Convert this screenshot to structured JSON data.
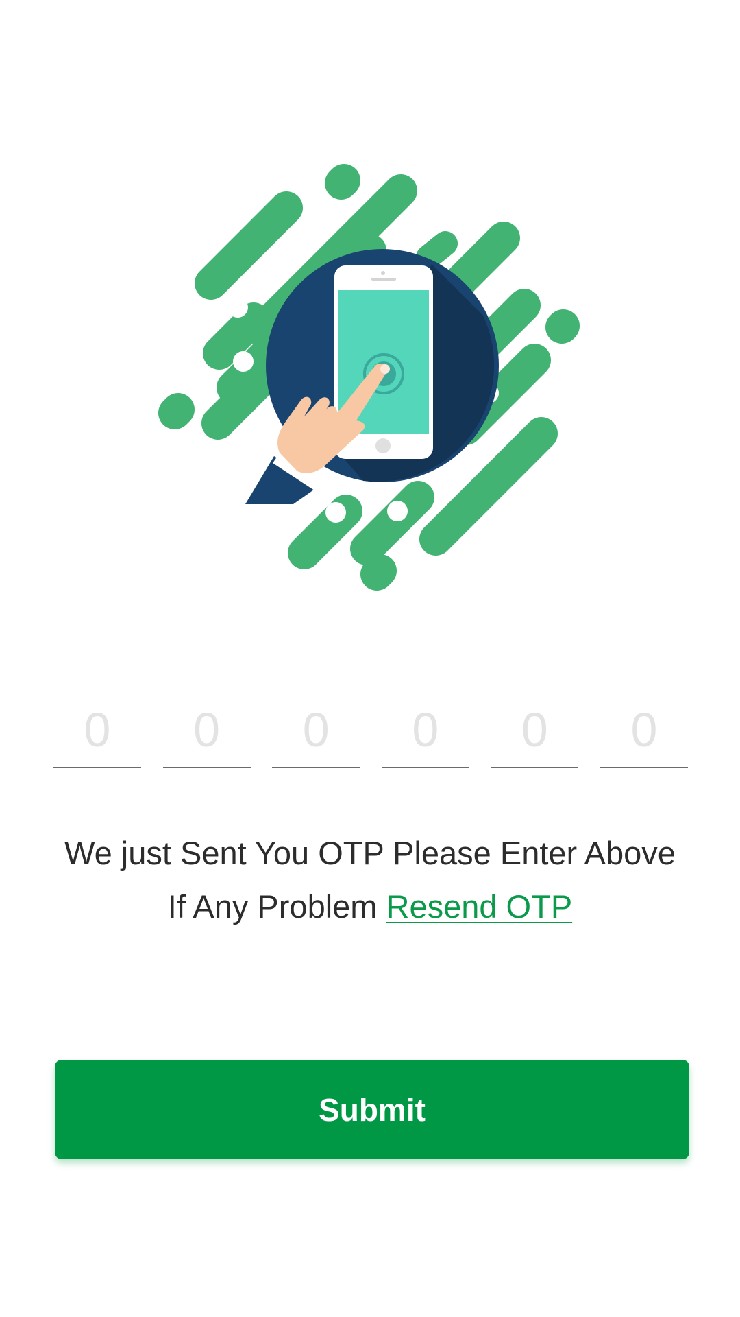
{
  "illustration": {
    "icon": "phone-tap-icon",
    "colors": {
      "stripes": "#43b374",
      "circle": "#1a4470",
      "screen": "#54d6bb",
      "phone": "#ffffff",
      "skin": "#f8c7a4",
      "sleeve": "#1a4470"
    }
  },
  "otp": {
    "digits": [
      {
        "placeholder": "0",
        "value": ""
      },
      {
        "placeholder": "0",
        "value": ""
      },
      {
        "placeholder": "0",
        "value": ""
      },
      {
        "placeholder": "0",
        "value": ""
      },
      {
        "placeholder": "0",
        "value": ""
      },
      {
        "placeholder": "0",
        "value": ""
      }
    ]
  },
  "message": {
    "line1": "We just Sent You OTP Please Enter Above",
    "line2_prefix": "If Any Problem",
    "resend_link": "Resend OTP",
    "link_color": "#0b9a4a"
  },
  "submit": {
    "label": "Submit",
    "color": "#009845"
  }
}
